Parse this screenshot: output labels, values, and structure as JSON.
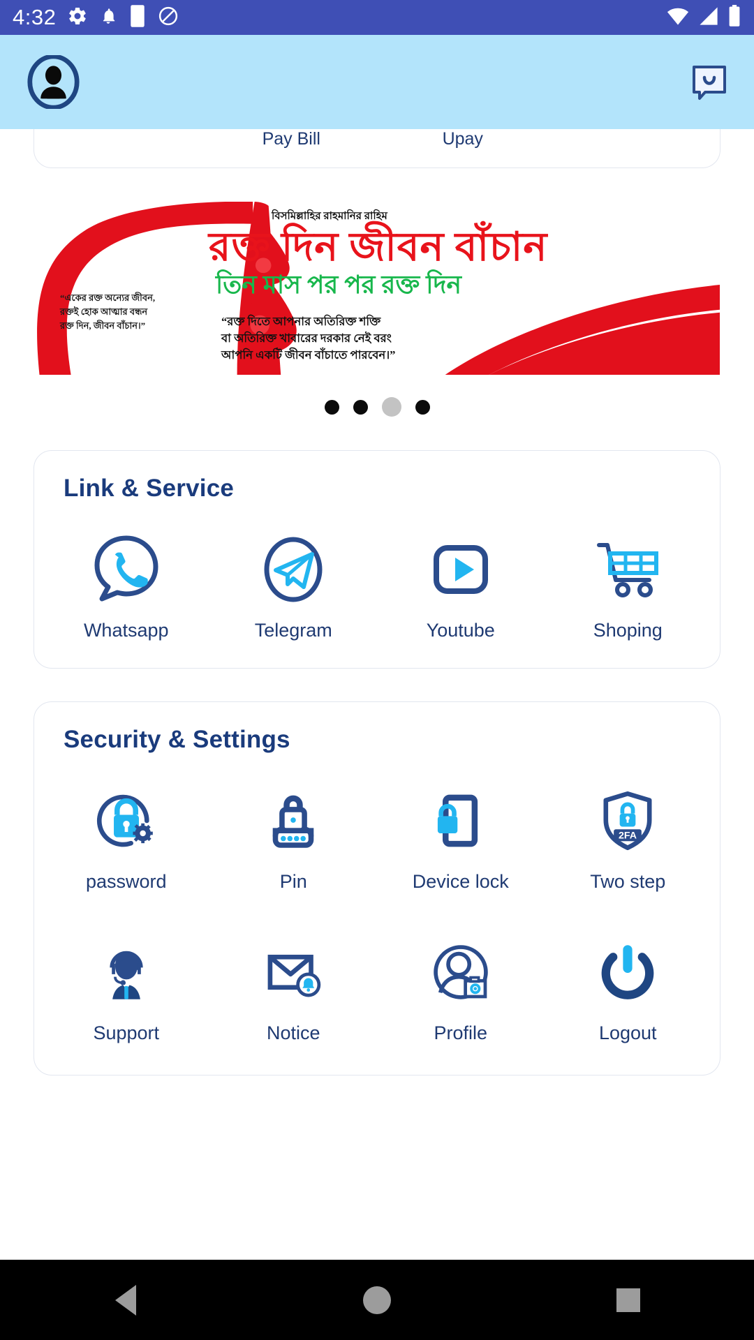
{
  "statusbar": {
    "time": "4:32",
    "left_icons": [
      "gear-icon",
      "bell-icon",
      "battery-square-icon",
      "do-not-disturb-icon"
    ],
    "right_icons": [
      "wifi-icon",
      "signal-icon",
      "battery-icon"
    ],
    "background": "#3f4fb5"
  },
  "header": {
    "avatar_name": "user-avatar",
    "chat_name": "chat-bubble-icon",
    "background": "#b3e4fb"
  },
  "partial_card": {
    "items": [
      {
        "label": ""
      },
      {
        "label": "Pay Bill"
      },
      {
        "label": "Upay"
      },
      {
        "label": ""
      }
    ]
  },
  "banner": {
    "bismillah": "বিসমিল্লাহির রাহমানির রাহিম",
    "title": "রক্ত দিন জীবন বাঁচান",
    "subtitle": "তিন মাস পর পর রক্ত দিন",
    "quote_left": "“একের রক্ত অন্যের জীবন,\nরক্তই হোক আত্মার বন্ধন\nরক্ত দিন, জীবন বাঁচান।”",
    "quote_right": "“রক্ত দিতে আপনার অতিরিক্ত শক্তি\nবা অতিরিক্ত খাবারের দরকার নেই বরং\nআপনি একটি জীবন বাঁচাতে পারবেন।”",
    "colors": {
      "title": "#e8131b",
      "subtitle": "#18b74c",
      "blood": "#e2101c"
    }
  },
  "carousel": {
    "total": 4,
    "active_index": 2,
    "dot_color": "#0b0b0b",
    "active_dot_color": "#c3c3c3"
  },
  "link_service": {
    "title": "Link & Service",
    "items": [
      {
        "label": "Whatsapp",
        "icon": "whatsapp-icon"
      },
      {
        "label": "Telegram",
        "icon": "telegram-icon"
      },
      {
        "label": "Youtube",
        "icon": "youtube-icon"
      },
      {
        "label": "Shoping",
        "icon": "shopping-cart-icon"
      }
    ]
  },
  "security_settings": {
    "title": "Security & Settings",
    "row1": [
      {
        "label": "password",
        "icon": "password-gear-lock-icon"
      },
      {
        "label": "Pin",
        "icon": "pin-padlock-icon"
      },
      {
        "label": "Device lock",
        "icon": "device-lock-icon"
      },
      {
        "label": "Two step",
        "icon": "two-factor-shield-icon",
        "badge": "2FA"
      }
    ],
    "row2": [
      {
        "label": "Support",
        "icon": "support-headset-icon"
      },
      {
        "label": "Notice",
        "icon": "envelope-bell-icon"
      },
      {
        "label": "Profile",
        "icon": "profile-camera-icon"
      },
      {
        "label": "Logout",
        "icon": "power-off-icon"
      }
    ]
  },
  "navbar": {
    "buttons": [
      {
        "name": "back-button",
        "icon": "triangle-back-icon"
      },
      {
        "name": "home-button",
        "icon": "circle-home-icon"
      },
      {
        "name": "recents-button",
        "icon": "square-recents-icon"
      }
    ],
    "background": "#000000"
  },
  "theme": {
    "navy": "#1f3a72",
    "deep_navy": "#2b4c8c",
    "cyan": "#22b5f0",
    "card_border": "#e2e6ef"
  }
}
